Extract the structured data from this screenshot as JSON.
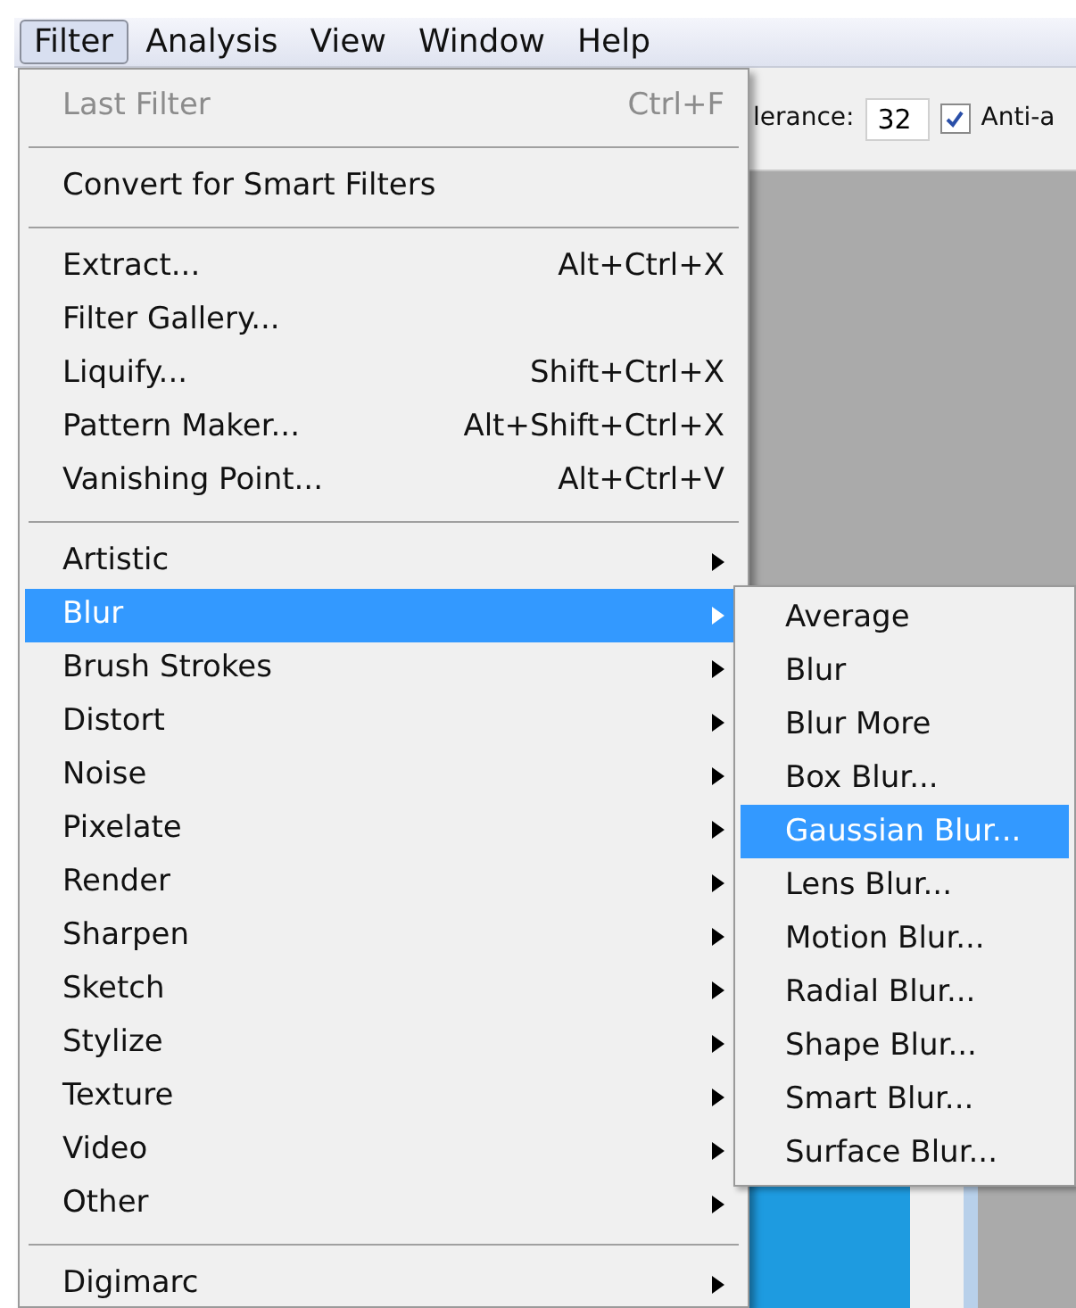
{
  "menubar": [
    {
      "label": "Filter",
      "selected": true
    },
    {
      "label": "Analysis",
      "selected": false
    },
    {
      "label": "View",
      "selected": false
    },
    {
      "label": "Window",
      "selected": false
    },
    {
      "label": "Help",
      "selected": false
    }
  ],
  "options_bar": {
    "label": "lerance:",
    "value": "32",
    "checkbox": {
      "label": "Anti-a",
      "checked": true
    }
  },
  "menu": {
    "items": [
      {
        "kind": "item",
        "label": "Last Filter",
        "shortcut": "Ctrl+F",
        "disabled": true,
        "submenu": false,
        "selected": false
      },
      {
        "kind": "separator"
      },
      {
        "kind": "item",
        "label": "Convert for Smart Filters",
        "disabled": false,
        "submenu": false,
        "selected": false
      },
      {
        "kind": "separator"
      },
      {
        "kind": "item",
        "label": "Extract...",
        "shortcut": "Alt+Ctrl+X",
        "disabled": false,
        "submenu": false,
        "selected": false
      },
      {
        "kind": "item",
        "label": "Filter Gallery...",
        "disabled": false,
        "submenu": false,
        "selected": false
      },
      {
        "kind": "item",
        "label": "Liquify...",
        "shortcut": "Shift+Ctrl+X",
        "disabled": false,
        "submenu": false,
        "selected": false
      },
      {
        "kind": "item",
        "label": "Pattern Maker...",
        "shortcut": "Alt+Shift+Ctrl+X",
        "disabled": false,
        "submenu": false,
        "selected": false
      },
      {
        "kind": "item",
        "label": "Vanishing Point...",
        "shortcut": "Alt+Ctrl+V",
        "disabled": false,
        "submenu": false,
        "selected": false
      },
      {
        "kind": "separator"
      },
      {
        "kind": "item",
        "label": "Artistic",
        "disabled": false,
        "submenu": true,
        "selected": false
      },
      {
        "kind": "item",
        "label": "Blur",
        "disabled": false,
        "submenu": true,
        "selected": true
      },
      {
        "kind": "item",
        "label": "Brush Strokes",
        "disabled": false,
        "submenu": true,
        "selected": false
      },
      {
        "kind": "item",
        "label": "Distort",
        "disabled": false,
        "submenu": true,
        "selected": false
      },
      {
        "kind": "item",
        "label": "Noise",
        "disabled": false,
        "submenu": true,
        "selected": false
      },
      {
        "kind": "item",
        "label": "Pixelate",
        "disabled": false,
        "submenu": true,
        "selected": false
      },
      {
        "kind": "item",
        "label": "Render",
        "disabled": false,
        "submenu": true,
        "selected": false
      },
      {
        "kind": "item",
        "label": "Sharpen",
        "disabled": false,
        "submenu": true,
        "selected": false
      },
      {
        "kind": "item",
        "label": "Sketch",
        "disabled": false,
        "submenu": true,
        "selected": false
      },
      {
        "kind": "item",
        "label": "Stylize",
        "disabled": false,
        "submenu": true,
        "selected": false
      },
      {
        "kind": "item",
        "label": "Texture",
        "disabled": false,
        "submenu": true,
        "selected": false
      },
      {
        "kind": "item",
        "label": "Video",
        "disabled": false,
        "submenu": true,
        "selected": false
      },
      {
        "kind": "item",
        "label": "Other",
        "disabled": false,
        "submenu": true,
        "selected": false
      },
      {
        "kind": "separator"
      },
      {
        "kind": "item",
        "label": "Digimarc",
        "disabled": false,
        "submenu": true,
        "selected": false
      }
    ]
  },
  "submenu": {
    "items": [
      {
        "label": "Average",
        "selected": false
      },
      {
        "label": "Blur",
        "selected": false
      },
      {
        "label": "Blur More",
        "selected": false
      },
      {
        "label": "Box Blur...",
        "selected": false
      },
      {
        "label": "Gaussian Blur...",
        "selected": true
      },
      {
        "label": "Lens Blur...",
        "selected": false
      },
      {
        "label": "Motion Blur...",
        "selected": false
      },
      {
        "label": "Radial Blur...",
        "selected": false
      },
      {
        "label": "Shape Blur...",
        "selected": false
      },
      {
        "label": "Smart Blur...",
        "selected": false
      },
      {
        "label": "Surface Blur...",
        "selected": false
      }
    ]
  }
}
